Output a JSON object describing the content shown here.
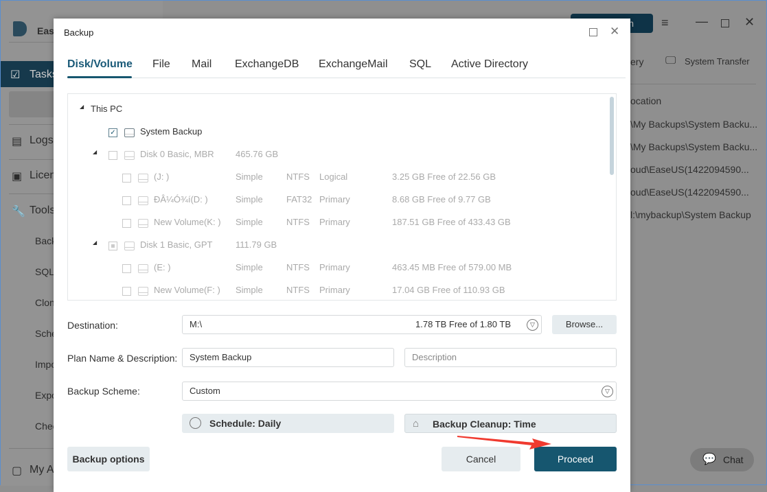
{
  "app": {
    "brand": "Ease",
    "sidebar": [
      {
        "label": "Tasks"
      },
      {
        "label": "Logs"
      },
      {
        "label": "Licen"
      },
      {
        "label": "Tools"
      }
    ],
    "tools": [
      "Back",
      "SQL",
      "Clon",
      "Sche",
      "Impo",
      "Expo",
      "Chec"
    ],
    "account": "My A",
    "top_button": "n",
    "toolbar": [
      "ery",
      "System Transfer"
    ],
    "location_header": "ocation",
    "locations": [
      "\\My Backups\\System Backu...",
      "\\My Backups\\System Backu...",
      "oud\\EaseUS(1422094590...",
      "oud\\EaseUS(1422094590...",
      "l:\\mybackup\\System Backup"
    ],
    "chat": "Chat"
  },
  "dialog": {
    "title": "Backup",
    "tabs": [
      "Disk/Volume",
      "File",
      "Mail",
      "ExchangeDB",
      "ExchangeMail",
      "SQL",
      "Active Directory"
    ],
    "active_tab": "Disk/Volume",
    "tree": {
      "root": "This PC",
      "system": "System Backup",
      "disks": [
        {
          "name": "Disk 0 Basic, MBR",
          "size": "465.76 GB",
          "volumes": [
            {
              "name": "(J: )",
              "type": "Simple",
              "fs": "NTFS",
              "part": "Logical",
              "free": "3.25 GB Free of 22.56 GB"
            },
            {
              "name": "ĐÂ¼Ó¾í(D: )",
              "type": "Simple",
              "fs": "FAT32",
              "part": "Primary",
              "free": "8.68 GB Free of 9.77 GB"
            },
            {
              "name": "New Volume(K: )",
              "type": "Simple",
              "fs": "NTFS",
              "part": "Primary",
              "free": "187.51 GB Free of 433.43 GB"
            }
          ]
        },
        {
          "name": "Disk 1 Basic, GPT",
          "size": "111.79 GB",
          "volumes": [
            {
              "name": "(E: )",
              "type": "Simple",
              "fs": "NTFS",
              "part": "Primary",
              "free": "463.45 MB Free of 579.00 MB"
            },
            {
              "name": "New Volume(F: )",
              "type": "Simple",
              "fs": "NTFS",
              "part": "Primary",
              "free": "17.04 GB Free of 110.93 GB"
            }
          ]
        }
      ]
    },
    "destination": {
      "label": "Destination:",
      "value": "M:\\",
      "free": "1.78 TB Free of 1.80 TB",
      "browse": "Browse..."
    },
    "plan": {
      "label": "Plan Name & Description:",
      "name": "System Backup",
      "description_placeholder": "Description"
    },
    "scheme": {
      "label": "Backup Scheme:",
      "value": "Custom"
    },
    "schedule": "Schedule: Daily",
    "cleanup": "Backup Cleanup: Time",
    "backup_options": "Backup options",
    "cancel": "Cancel",
    "proceed": "Proceed",
    "accent": "#16566f"
  }
}
